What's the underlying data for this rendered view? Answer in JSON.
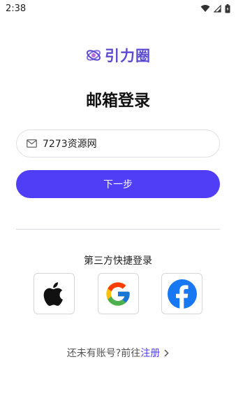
{
  "status_bar": {
    "time": "2:38"
  },
  "brand": {
    "name": "引力圈",
    "color": "#5a4bd1",
    "logo_icon": "orbit-logo-icon"
  },
  "page": {
    "title": "邮箱登录"
  },
  "email": {
    "value": "7273资源网",
    "icon": "mail-icon"
  },
  "actions": {
    "next_label": "下一步",
    "accent_color": "#4f3ef6"
  },
  "third_party": {
    "label": "第三方快捷登录",
    "providers": [
      "apple-icon",
      "google-icon",
      "facebook-icon"
    ]
  },
  "register": {
    "prompt": "还未有账号?前往",
    "link": "注册"
  }
}
